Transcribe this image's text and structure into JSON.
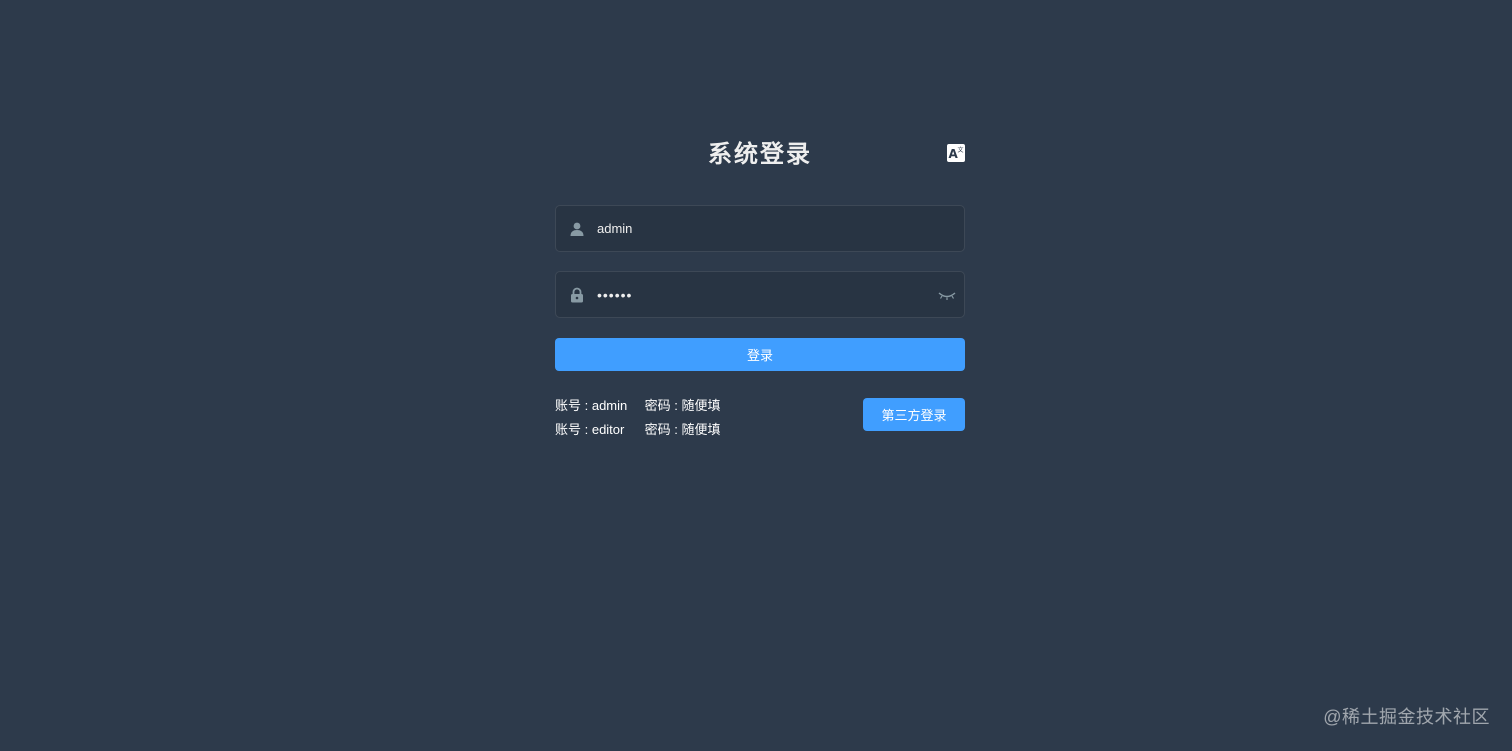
{
  "login": {
    "title": "系统登录",
    "lang_switch_icon": "translate-icon",
    "username": {
      "value": "admin",
      "icon": "user-icon"
    },
    "password": {
      "value": "123456",
      "icon": "lock-icon",
      "toggle_icon": "eye-closed-icon"
    },
    "submit_label": "登录"
  },
  "tips": [
    {
      "account": "账号 : admin",
      "password": "密码 : 随便填"
    },
    {
      "account": "账号 : editor",
      "password": "密码 : 随便填"
    }
  ],
  "third_party_label": "第三方登录",
  "watermark": "@稀土掘金技术社区",
  "colors": {
    "background": "#2d3a4b",
    "input_background": "#283443",
    "primary": "#409eff",
    "title_text": "#eeeeee"
  }
}
